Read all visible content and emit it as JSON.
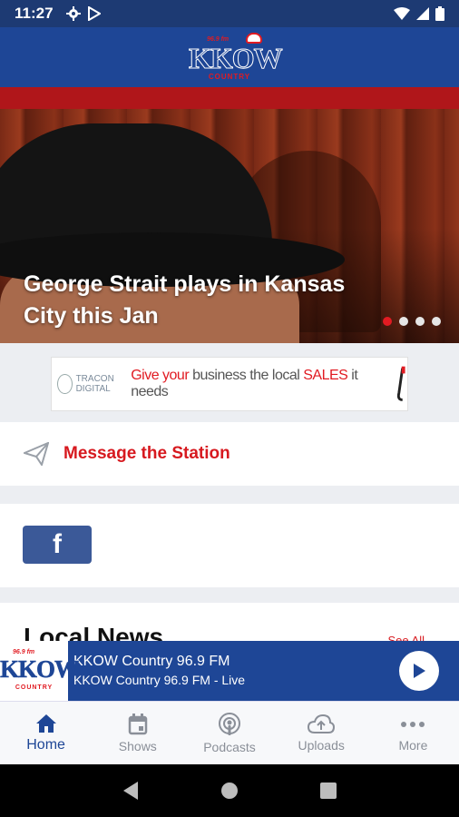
{
  "status_bar": {
    "time": "11:27"
  },
  "header": {
    "logo_small": "96.9 fm",
    "logo_main": "KKOW",
    "logo_sub": "COUNTRY"
  },
  "hero": {
    "title": "George Strait plays in Kansas City this Jan",
    "slides_total": 4,
    "slide_active": 1
  },
  "ad": {
    "brand": "TRACON DIGITAL",
    "text_a": "Give your",
    "text_b": "business the local",
    "text_c": "SALES",
    "text_d": "it needs"
  },
  "message": {
    "label": "Message the Station"
  },
  "social": {
    "facebook_glyph": "f"
  },
  "news": {
    "title": "Local News",
    "link": "See All"
  },
  "now_playing": {
    "title": "KKOW Country 96.9 FM",
    "subtitle": "KKOW Country 96.9 FM - Live"
  },
  "nav": {
    "items": [
      {
        "label": "Home",
        "icon": "home-icon"
      },
      {
        "label": "Shows",
        "icon": "calendar-icon"
      },
      {
        "label": "Podcasts",
        "icon": "podcast-icon"
      },
      {
        "label": "Uploads",
        "icon": "cloud-upload-icon"
      },
      {
        "label": "More",
        "icon": "more-icon"
      }
    ]
  },
  "colors": {
    "brand_blue": "#1e4696",
    "accent_red": "#d7191f",
    "facebook_blue": "#3b5998"
  }
}
